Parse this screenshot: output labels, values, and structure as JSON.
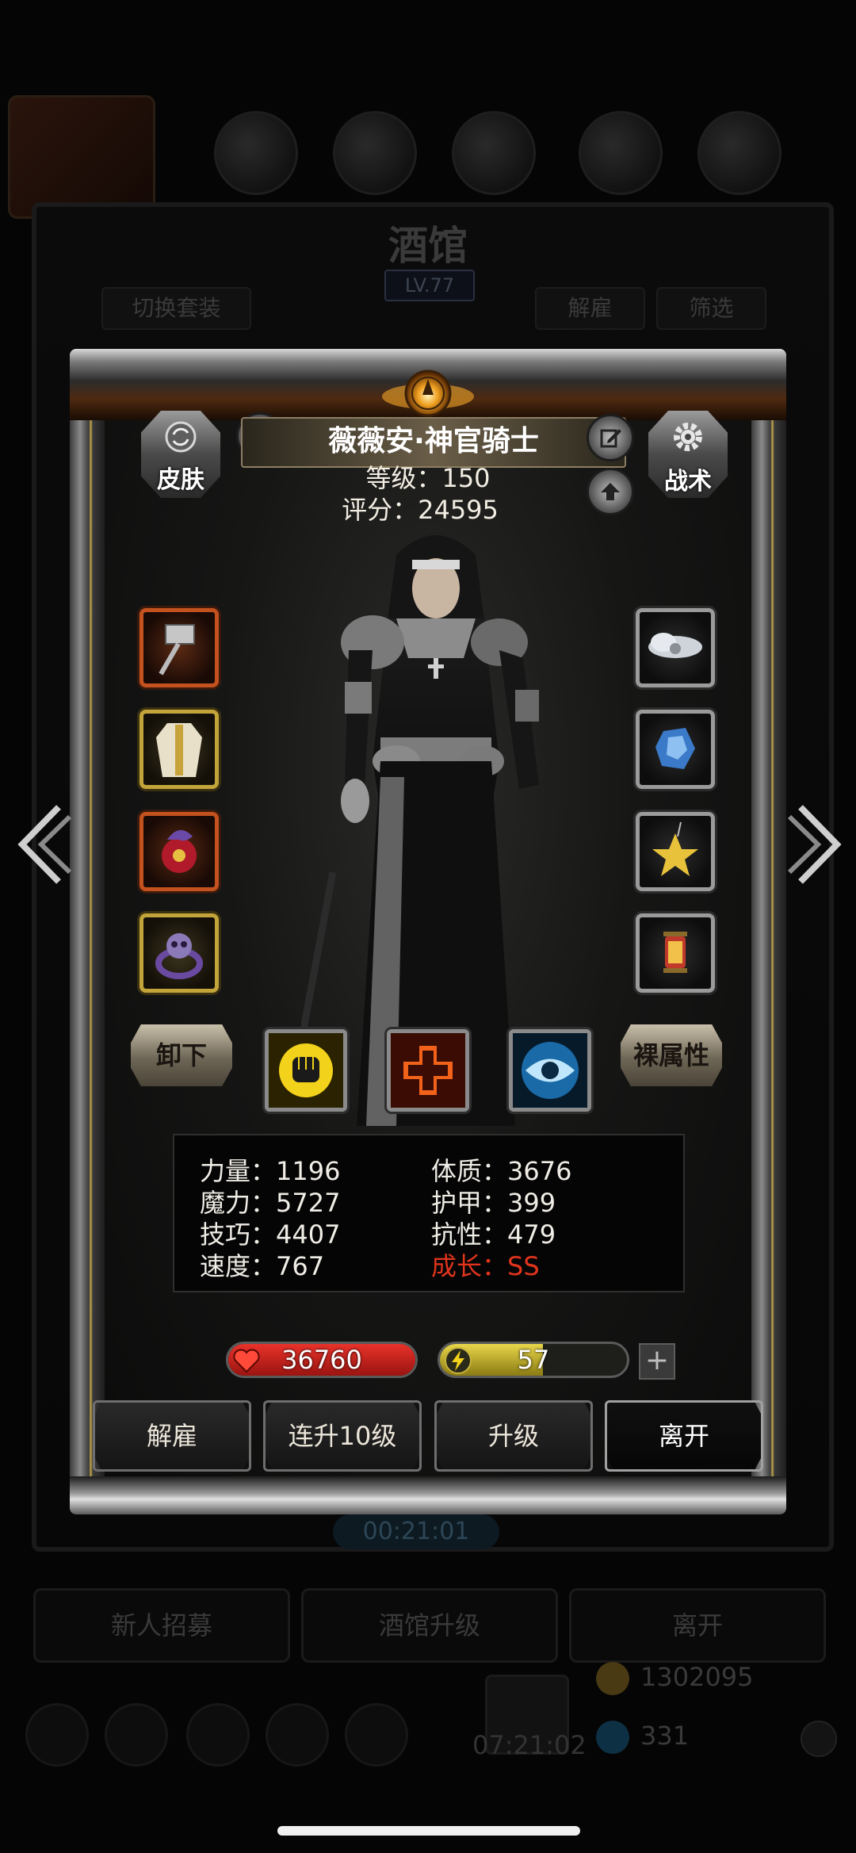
{
  "background": {
    "title": "酒馆",
    "level": "LV.77",
    "tabs": {
      "switch_outfit": "切换套装",
      "dismiss": "解雇",
      "filter": "筛选"
    },
    "timer": "00:21:01",
    "buttons": {
      "recruit": "新人招募",
      "upgrade_tavern": "酒馆升级",
      "leave": "离开"
    },
    "clock": "07:21:02",
    "gold": "1302095",
    "gems": "331"
  },
  "hero": {
    "name": "薇薇安·神官骑士",
    "level_line": "等级：150",
    "score_line": "评分：24595",
    "skin_label": "皮肤",
    "tactics_label": "战术"
  },
  "equipment": {
    "left": [
      {
        "icon": "warhammer-icon",
        "rarity": "red"
      },
      {
        "icon": "robe-icon",
        "rarity": "gold"
      },
      {
        "icon": "dragon-amulet-icon",
        "rarity": "red"
      },
      {
        "icon": "skull-ring-icon",
        "rarity": "gold"
      }
    ],
    "right": [
      {
        "icon": "cloud-charm-icon",
        "rarity": "grey"
      },
      {
        "icon": "blue-crystal-icon",
        "rarity": "grey"
      },
      {
        "icon": "star-pendant-icon",
        "rarity": "grey"
      },
      {
        "icon": "lantern-icon",
        "rarity": "grey"
      }
    ]
  },
  "actions": {
    "unequip": "卸下",
    "naked_stats": "裸属性",
    "skills": [
      "fist-skill-icon",
      "heal-cross-skill-icon",
      "eye-skill-icon"
    ]
  },
  "stats": {
    "strength": "力量：1196",
    "magic": "魔力：5727",
    "skill": "技巧：4407",
    "speed": "速度：767",
    "constitution": "体质：3676",
    "armor": "护甲：399",
    "resistance": "抗性：479",
    "growth": "成长：SS"
  },
  "bars": {
    "hp": "36760",
    "energy": "57",
    "energy_fill": 0.55,
    "plus": "+"
  },
  "buttons": {
    "dismiss": "解雇",
    "level_up_10": "连升10级",
    "level_up": "升级",
    "leave": "离开"
  },
  "colors": {
    "accent_gold": "#c2a43a",
    "rarity_red": "#c4521e",
    "growth_red": "#e0341c",
    "hp_red": "#c8221a",
    "energy_yellow": "#c8b43a"
  }
}
